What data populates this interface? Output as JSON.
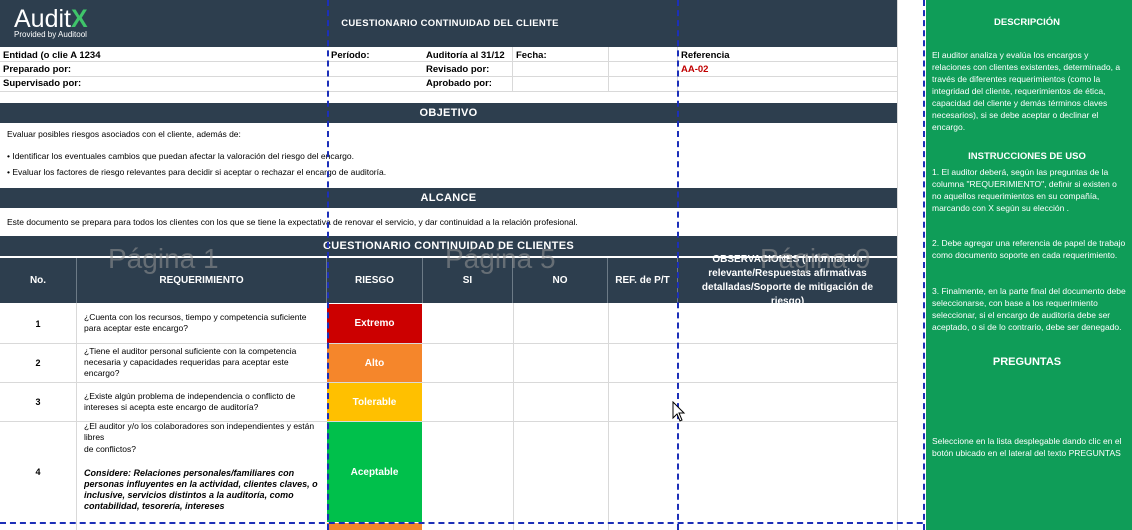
{
  "header": {
    "logo_main": "Audit",
    "logo_x": "X",
    "logo_sub": "Provided by Auditool",
    "title": "CUESTIONARIO CONTINUIDAD DEL CLIENTE"
  },
  "info": {
    "entidad": "Entidad (o clie A 1234",
    "periodo": "Período:",
    "auditoria": "Auditoría al 31/12",
    "fecha": "Fecha:",
    "referencia": "Referencia",
    "preparado": "Preparado por:",
    "revisado": "Revisado por:",
    "ref_code": "AA-02",
    "supervisado": "Supervisado por:",
    "aprobado": "Aprobado por:"
  },
  "objetivo": {
    "title": "OBJETIVO",
    "line1": "Evaluar posibles riesgos asociados con el cliente, además de:",
    "line2": "• Identificar los eventuales cambios que puedan afectar la valoración del riesgo del encargo.",
    "line3": "• Evaluar los factores de riesgo relevantes para decidir si aceptar o rechazar el encargo de auditoría."
  },
  "alcance": {
    "title": "ALCANCE",
    "text": "Este documento se prepara para todos los clientes con los que se tiene la expectativa de renovar el servicio, y dar continuidad a la relación profesional."
  },
  "cuestionario": {
    "title": "CUESTIONARIO CONTINUIDAD DE CLIENTES",
    "columns": {
      "no": "No.",
      "requerimiento": "REQUERIMIENTO",
      "riesgo": "RIESGO",
      "si": "SI",
      "no_col": "NO",
      "ref": "REF. de P/T",
      "obs": "OBSERVACIONES (Información relevante/Respuestas afirmativas detalladas/Soporte de mitigación de riesgo)"
    },
    "rows": [
      {
        "no": "1",
        "req": "¿Cuenta con los recursos, tiempo y competencia suficiente para aceptar este encargo?",
        "risk": "Extremo",
        "color": "#cc0000"
      },
      {
        "no": "2",
        "req": "¿Tiene el auditor personal suficiente con la competencia necesaria y capacidades requeridas para aceptar este encargo?",
        "risk": "Alto",
        "color": "#f5862b"
      },
      {
        "no": "3",
        "req": "¿Existe algún problema de independencia o conflicto de intereses si acepta este encargo de auditoría?",
        "risk": "Tolerable",
        "color": "#ffc000"
      },
      {
        "no": "4",
        "req_a": "¿El auditor y/o los colaboradores son independientes y están libres",
        "req_b": "de conflictos?",
        "consider": "Considere: Relaciones personales/familiares con personas influyentes en la actividad, clientes claves, o inclusive, servicios distintos a la auditoría, como contabilidad, tesorería, intereses",
        "risk": "Aceptable",
        "color": "#00c04b"
      }
    ]
  },
  "watermarks": {
    "p1": "Página 1",
    "p5": "Página 5",
    "p9": "Página 9"
  },
  "sidebar": {
    "desc_title": "DESCRIPCIÓN",
    "desc_text": "El auditor analiza y evalúa los encargos y relaciones con clientes existentes, determinado, a través de diferentes requerimientos (como la integridad del cliente, requerimientos de ética, capacidad del cliente y demás términos claves necesarios), si se debe aceptar o declinar el encargo.",
    "instr_title": "INSTRUCCIONES DE USO",
    "instr1": "1. El auditor deberá, según las preguntas de la columna \"REQUERIMIENTO\", definir si existen o no aquellos requerimientos en su compañía, marcando con X según su elección .",
    "instr2": "2. Debe agregar una referencia de papel de trabajo como documento soporte en cada requerimiento.",
    "instr3": "3. Finalmente, en la parte final del documento debe seleccionarse, con base a los requerimiento seleccionar, si el encargo de auditoría debe ser aceptado, o si de lo contrario, debe ser denegado.",
    "preguntas_title": "PREGUNTAS",
    "preguntas_text": "Seleccione en la lista desplegable dando clic en el botón ubicado en el lateral del texto PREGUNTAS"
  }
}
